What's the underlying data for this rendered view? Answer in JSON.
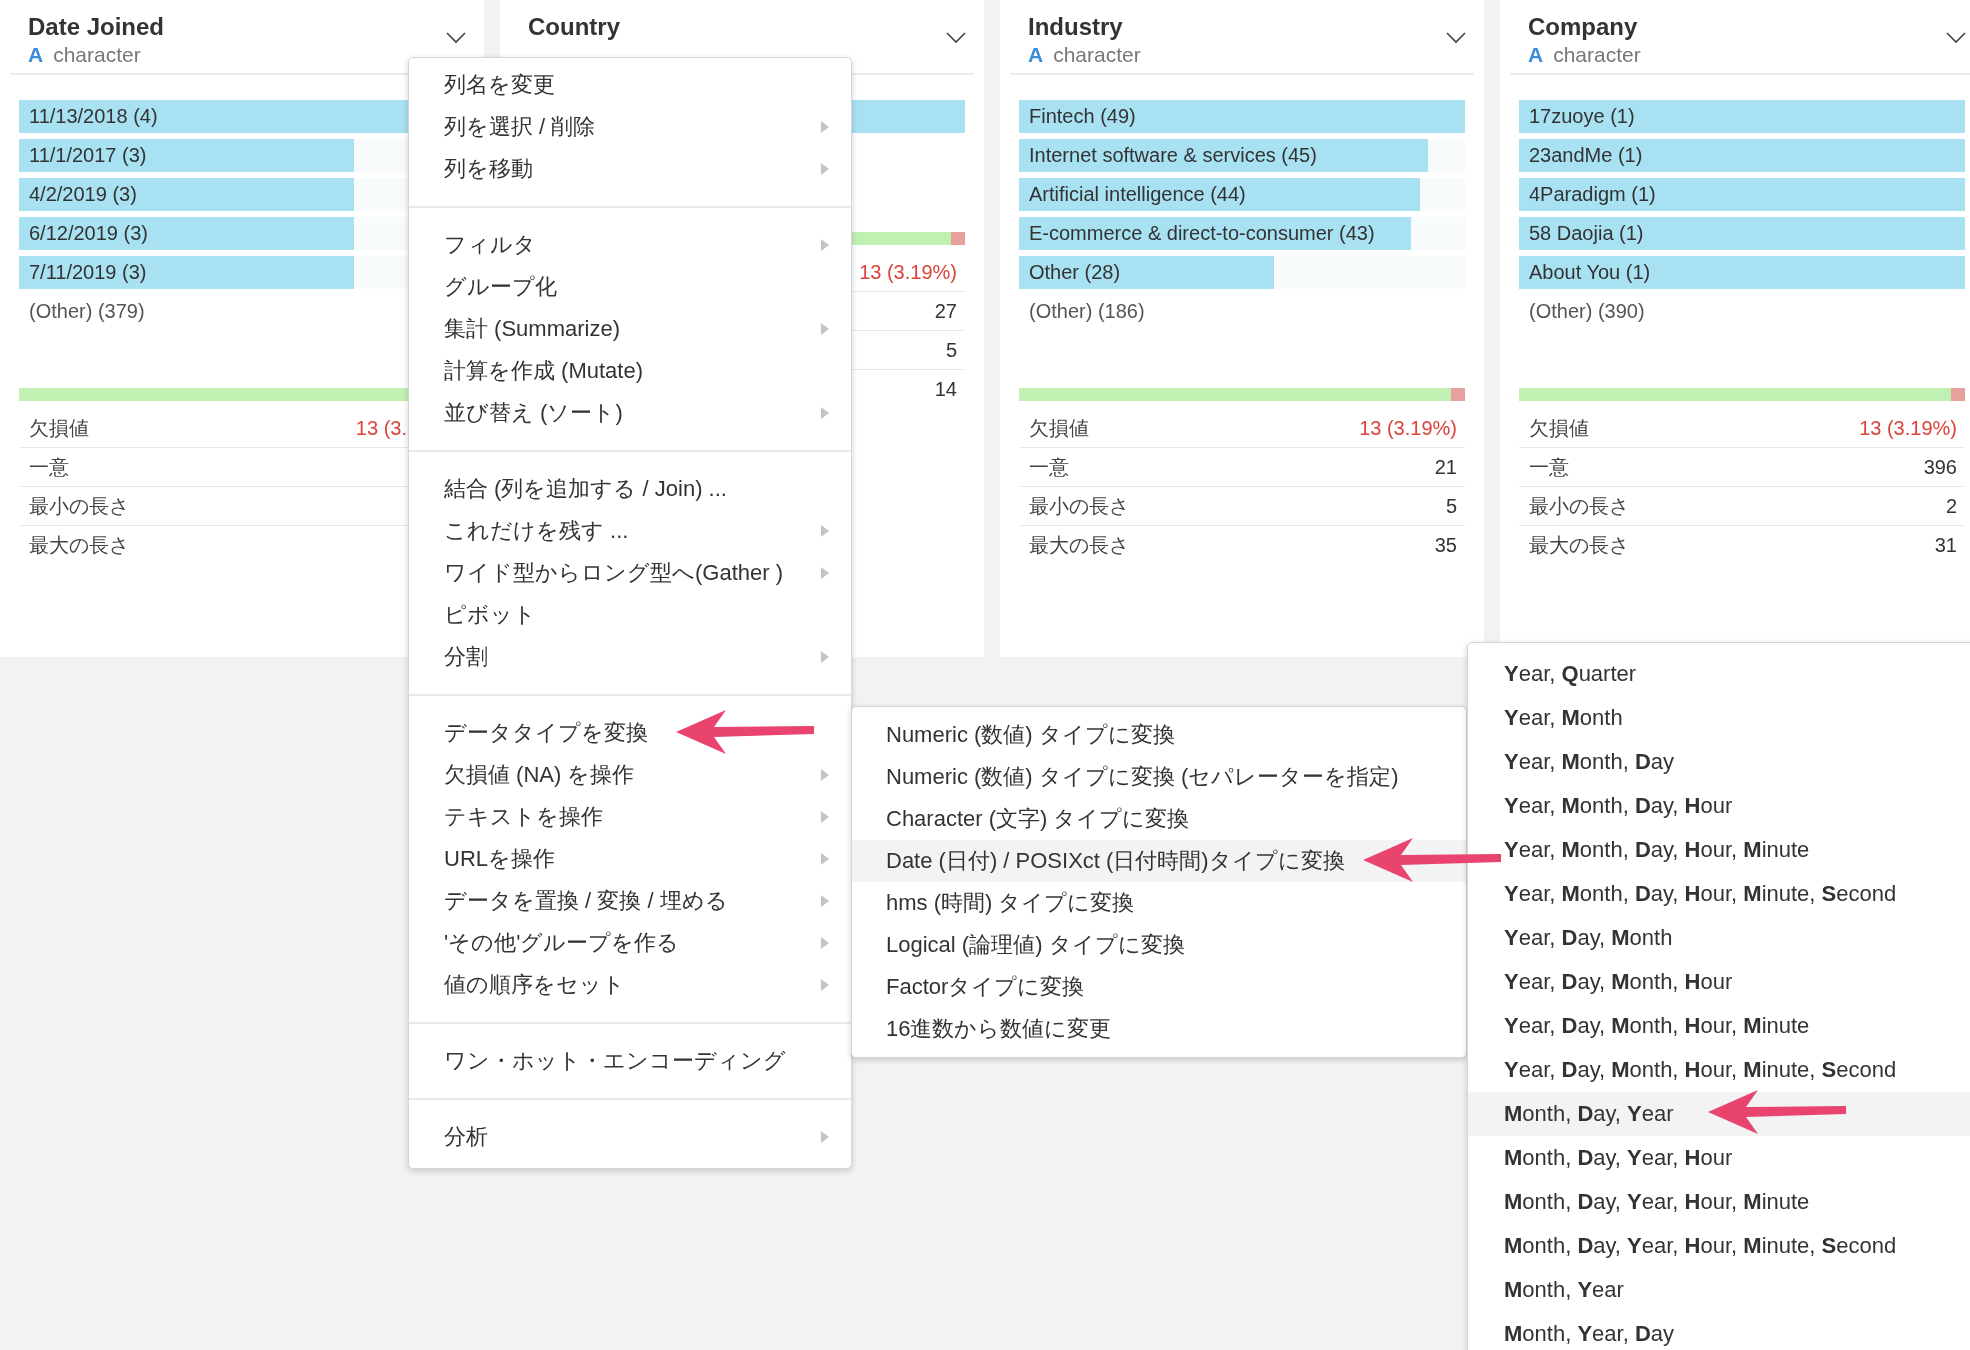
{
  "cards": [
    {
      "title": "Date Joined",
      "type_icon": "A",
      "type": "character",
      "bars": [
        {
          "label": "11/13/2018 (4)",
          "level": 1
        },
        {
          "label": "11/1/2017 (3)",
          "level": 0.75
        },
        {
          "label": "4/2/2019 (3)",
          "level": 0.75
        },
        {
          "label": "6/12/2019 (3)",
          "level": 0.75
        },
        {
          "label": "7/11/2019 (3)",
          "level": 0.75
        }
      ],
      "other": "(Other) (379)",
      "missing": {
        "level": 0.968
      },
      "stats": [
        {
          "kind": "missing",
          "label": "欠損値",
          "value": "13 (3."
        },
        {
          "kind": "count",
          "label": "一意"
        },
        {
          "kind": "count",
          "label": "最小の長さ"
        },
        {
          "kind": "count",
          "label": "最大の長さ"
        }
      ]
    },
    {
      "title": "Country",
      "bars": [
        {
          "level": 1
        }
      ],
      "missing": {
        "level": 0.968
      },
      "stats": [
        {
          "kind": "missing",
          "value": "13 (3.19%)"
        },
        {
          "kind": "count",
          "value": "27"
        },
        {
          "kind": "count",
          "value": "5"
        },
        {
          "kind": "count",
          "value": "14"
        }
      ]
    },
    {
      "title": "Industry",
      "type_icon": "A",
      "type": "character",
      "bars": [
        {
          "label": "Fintech (49)",
          "level": 1
        },
        {
          "label": "Internet software & services (45)",
          "level": 0.918
        },
        {
          "label": "Artificial intelligence (44)",
          "level": 0.898
        },
        {
          "label": "E-commerce & direct-to-consumer (43)",
          "level": 0.878
        },
        {
          "label": "Other (28)",
          "level": 0.571
        }
      ],
      "other": "(Other) (186)",
      "missing": {
        "level": 0.968
      },
      "stats": [
        {
          "kind": "missing",
          "label": "欠損値",
          "value": "13 (3.19%)"
        },
        {
          "kind": "count",
          "label": "一意",
          "value": "21"
        },
        {
          "kind": "count",
          "label": "最小の長さ",
          "value": "5"
        },
        {
          "kind": "count",
          "label": "最大の長さ",
          "value": "35"
        }
      ]
    },
    {
      "title": "Company",
      "type_icon": "A",
      "type": "character",
      "bars": [
        {
          "label": "17zuoye (1)",
          "level": 1
        },
        {
          "label": "23andMe (1)",
          "level": 1
        },
        {
          "label": "4Paradigm (1)",
          "level": 1
        },
        {
          "label": "58 Daojia (1)",
          "level": 1
        },
        {
          "label": "About You (1)",
          "level": 1
        }
      ],
      "other": "(Other) (390)",
      "missing": {
        "level": 0.968
      },
      "stats": [
        {
          "kind": "missing",
          "label": "欠損値",
          "value": "13 (3.19%)"
        },
        {
          "kind": "count",
          "label": "一意",
          "value": "396"
        },
        {
          "kind": "count",
          "label": "最小の長さ",
          "value": "2"
        },
        {
          "kind": "count",
          "label": "最大の長さ",
          "value": "31"
        }
      ]
    }
  ],
  "context_menu": {
    "groups": [
      {
        "items": [
          {
            "label": "列名を変更",
            "submenu": false
          },
          {
            "label": "列を選択 / 削除",
            "submenu": true
          },
          {
            "label": "列を移動",
            "submenu": true
          }
        ]
      },
      {
        "items": [
          {
            "label": "フィルタ",
            "submenu": true
          },
          {
            "label": "グループ化",
            "submenu": false
          },
          {
            "label": "集計 (Summarize)",
            "submenu": true
          },
          {
            "label": "計算を作成 (Mutate)",
            "submenu": false
          },
          {
            "label": "並び替え (ソート)",
            "submenu": true
          }
        ]
      },
      {
        "items": [
          {
            "label": "結合 (列を追加する / Join) ...",
            "submenu": false
          },
          {
            "label": "これだけを残す ...",
            "submenu": true
          },
          {
            "label": "ワイド型からロング型へ(Gather )",
            "submenu": true
          },
          {
            "label": "ピボット",
            "submenu": false
          },
          {
            "label": "分割",
            "submenu": true
          }
        ]
      },
      {
        "items": [
          {
            "label": "データタイプを変換",
            "submenu": false
          },
          {
            "label": "欠損値 (NA) を操作",
            "submenu": true
          },
          {
            "label": "テキストを操作",
            "submenu": true
          },
          {
            "label": "URLを操作",
            "submenu": true
          },
          {
            "label": "データを置換 / 変換 / 埋める",
            "submenu": true
          },
          {
            "label": "'その他'グループを作る",
            "submenu": true
          },
          {
            "label": "値の順序をセット",
            "submenu": true
          }
        ]
      },
      {
        "items": [
          {
            "label": "ワン・ホット・エンコーディング",
            "submenu": false
          }
        ]
      },
      {
        "items": [
          {
            "label": "分析",
            "submenu": true
          }
        ]
      }
    ]
  },
  "type_menu": {
    "items": [
      {
        "label": "Numeric (数値) タイプに変換",
        "selected": false
      },
      {
        "label": "Numeric (数値) タイプに変換 (セパレーターを指定)",
        "selected": false
      },
      {
        "label": "Character (文字) タイプに変換",
        "selected": false
      },
      {
        "label": "Date (日付) / POSIXct (日付時間)タイプに変換",
        "selected": true
      },
      {
        "label": "hms (時間) タイプに変換",
        "selected": false
      },
      {
        "label": "Logical (論理値) タイプに変換",
        "selected": false
      },
      {
        "label": "Factorタイプに変換",
        "selected": false
      },
      {
        "label": "16進数から数値に変更",
        "selected": false
      }
    ]
  },
  "date_format_menu": {
    "items": [
      {
        "label": "**Y**ear, **Q**uarter",
        "selected": false
      },
      {
        "label": "**Y**ear, **M**onth",
        "selected": false
      },
      {
        "label": "**Y**ear, **M**onth, **D**ay",
        "selected": false
      },
      {
        "label": "**Y**ear, **M**onth, **D**ay, **H**our",
        "selected": false
      },
      {
        "label": "**Y**ear, **M**onth, **D**ay, **H**our, **M**inute",
        "selected": false
      },
      {
        "label": "**Y**ear, **M**onth, **D**ay, **H**our, **M**inute, **S**econd",
        "selected": false
      },
      {
        "label": "**Y**ear, **D**ay, **M**onth",
        "selected": false
      },
      {
        "label": "**Y**ear, **D**ay, **M**onth, **H**our",
        "selected": false
      },
      {
        "label": "**Y**ear, **D**ay, **M**onth, **H**our, **M**inute",
        "selected": false
      },
      {
        "label": "**Y**ear, **D**ay, **M**onth, **H**our, **M**inute, **S**econd",
        "selected": false
      },
      {
        "label": "**M**onth, **D**ay, **Y**ear",
        "selected": true
      },
      {
        "label": "**M**onth, **D**ay, **Y**ear, **H**our",
        "selected": false
      },
      {
        "label": "**M**onth, **D**ay, **Y**ear, **H**our, **M**inute",
        "selected": false
      },
      {
        "label": "**M**onth, **D**ay, **Y**ear, **H**our, **M**inute, **S**econd",
        "selected": false
      },
      {
        "label": "**M**onth, **Y**ear",
        "selected": false
      },
      {
        "label": "**M**onth, **Y**ear, **D**ay",
        "selected": false
      }
    ]
  }
}
